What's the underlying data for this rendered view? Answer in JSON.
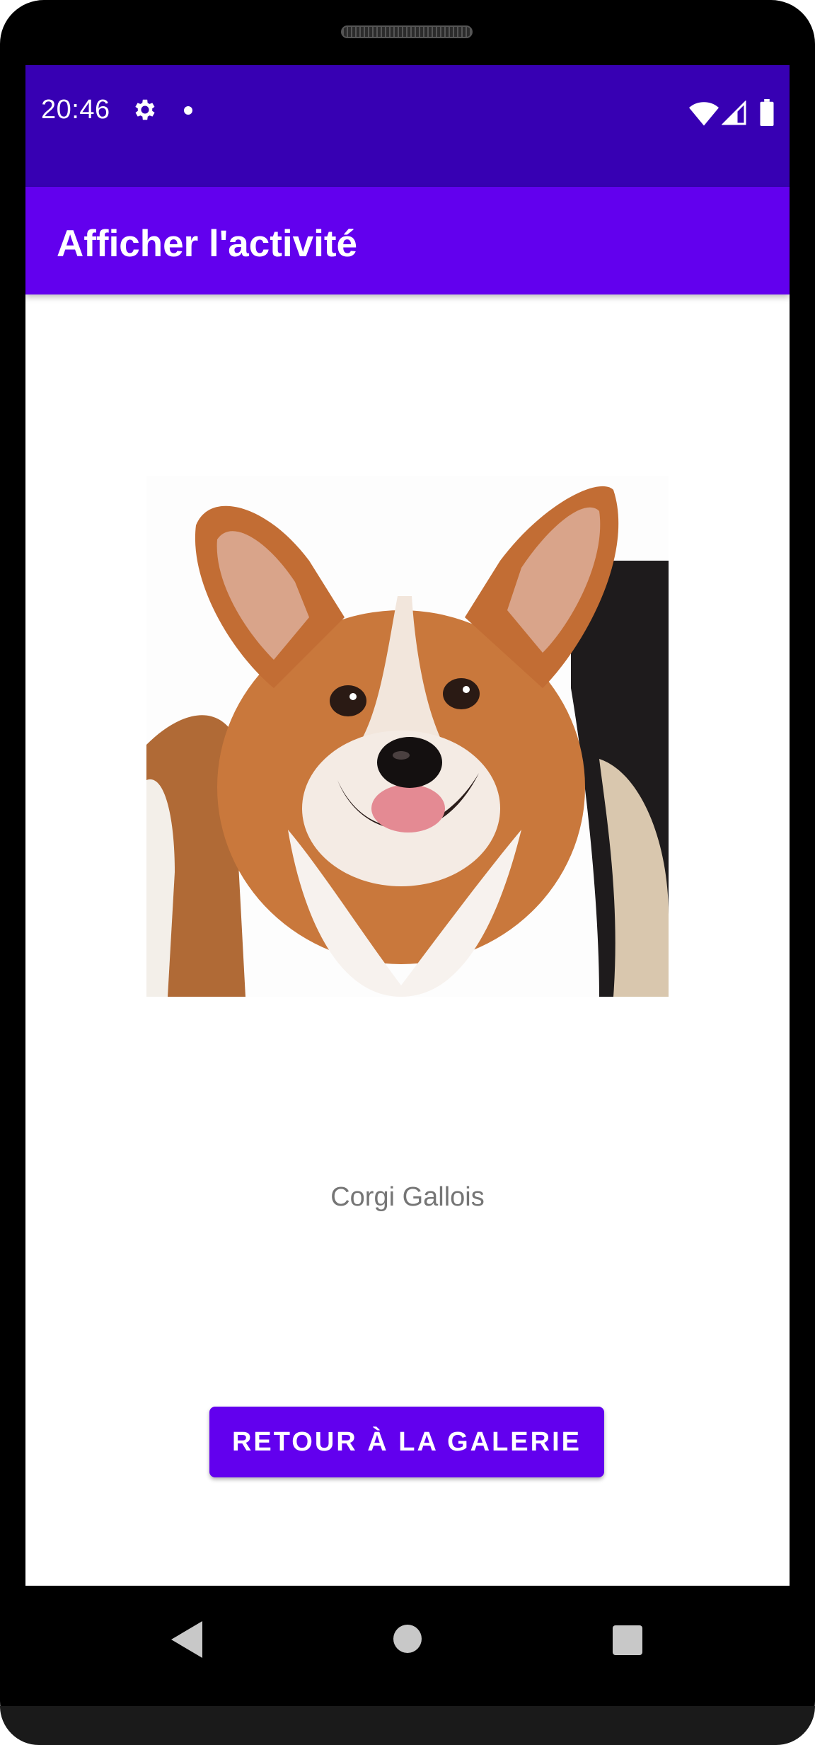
{
  "status_bar": {
    "time": "20:46",
    "icons": [
      "gear-icon",
      "notification-dot-icon",
      "wifi-icon",
      "signal-icon",
      "battery-icon"
    ]
  },
  "app_bar": {
    "title": "Afficher l'activité"
  },
  "content": {
    "image_subject": "corgi",
    "caption": "Corgi Gallois",
    "back_button_label": "RETOUR À LA GALERIE"
  },
  "nav_bar": {
    "icons": [
      "back-triangle-icon",
      "home-circle-icon",
      "recents-square-icon"
    ]
  },
  "colors": {
    "status_bar": "#3700b3",
    "app_bar": "#6200ee",
    "button": "#6200ee",
    "caption_text": "#757575"
  }
}
